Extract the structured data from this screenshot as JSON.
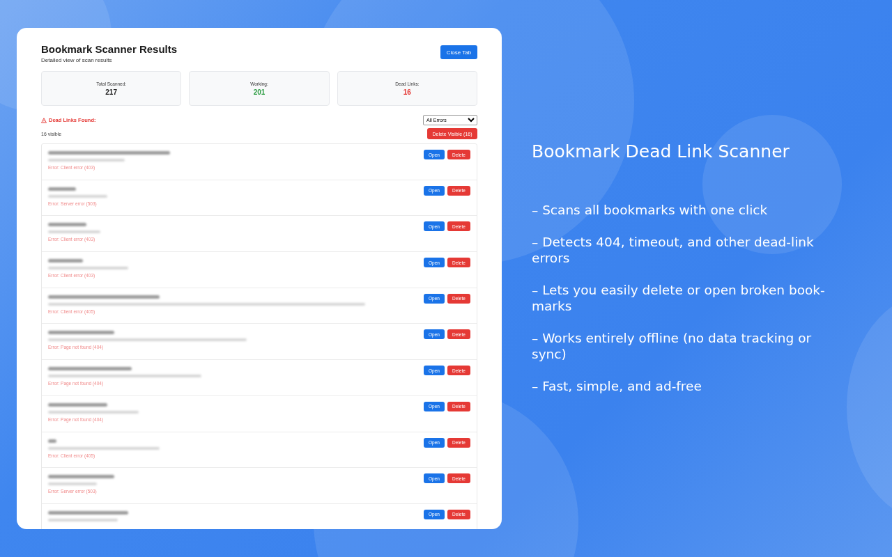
{
  "results": {
    "title": "Bookmark Scanner Results",
    "subtitle": "Detailed view of scan results",
    "close_button": "Close Tab",
    "stats": [
      {
        "label": "Total Scanned:",
        "value": "217",
        "kind": "total"
      },
      {
        "label": "Working:",
        "value": "201",
        "kind": "ok"
      },
      {
        "label": "Dead Links:",
        "value": "16",
        "kind": "dead"
      }
    ],
    "section_title": "Dead Links Found:",
    "filter": {
      "value": "All Errors"
    },
    "count": "16 visible",
    "delete_visible_button": "Delete Visible (16)",
    "rows": [
      {
        "error": "Error: Client error (403)",
        "open": "Open",
        "delete": "Delete"
      },
      {
        "error": "Error: Server error (503)",
        "open": "Open",
        "delete": "Delete"
      },
      {
        "error": "Error: Client error (403)",
        "open": "Open",
        "delete": "Delete"
      },
      {
        "error": "Error: Client error (403)",
        "open": "Open",
        "delete": "Delete"
      },
      {
        "error": "Error: Client error (405)",
        "open": "Open",
        "delete": "Delete"
      },
      {
        "error": "Error: Page not found (404)",
        "open": "Open",
        "delete": "Delete"
      },
      {
        "error": "Error: Page not found (404)",
        "open": "Open",
        "delete": "Delete"
      },
      {
        "error": "Error: Page not found (404)",
        "open": "Open",
        "delete": "Delete"
      },
      {
        "error": "Error: Client error (405)",
        "open": "Open",
        "delete": "Delete"
      },
      {
        "error": "Error: Server error (503)",
        "open": "Open",
        "delete": "Delete"
      },
      {
        "open": "Open",
        "delete": "Delete"
      }
    ]
  },
  "promo": {
    "heading": "Bookmark Dead Link Scanner",
    "features": [
      "– Scans all bookmarks with one click",
      "– Detects 404, timeout, and other dead-link errors",
      "– Lets you easily delete or open broken book-marks",
      "– Works entirely offline (no data tracking or sync)",
      "– Fast, simple, and ad-free"
    ]
  }
}
